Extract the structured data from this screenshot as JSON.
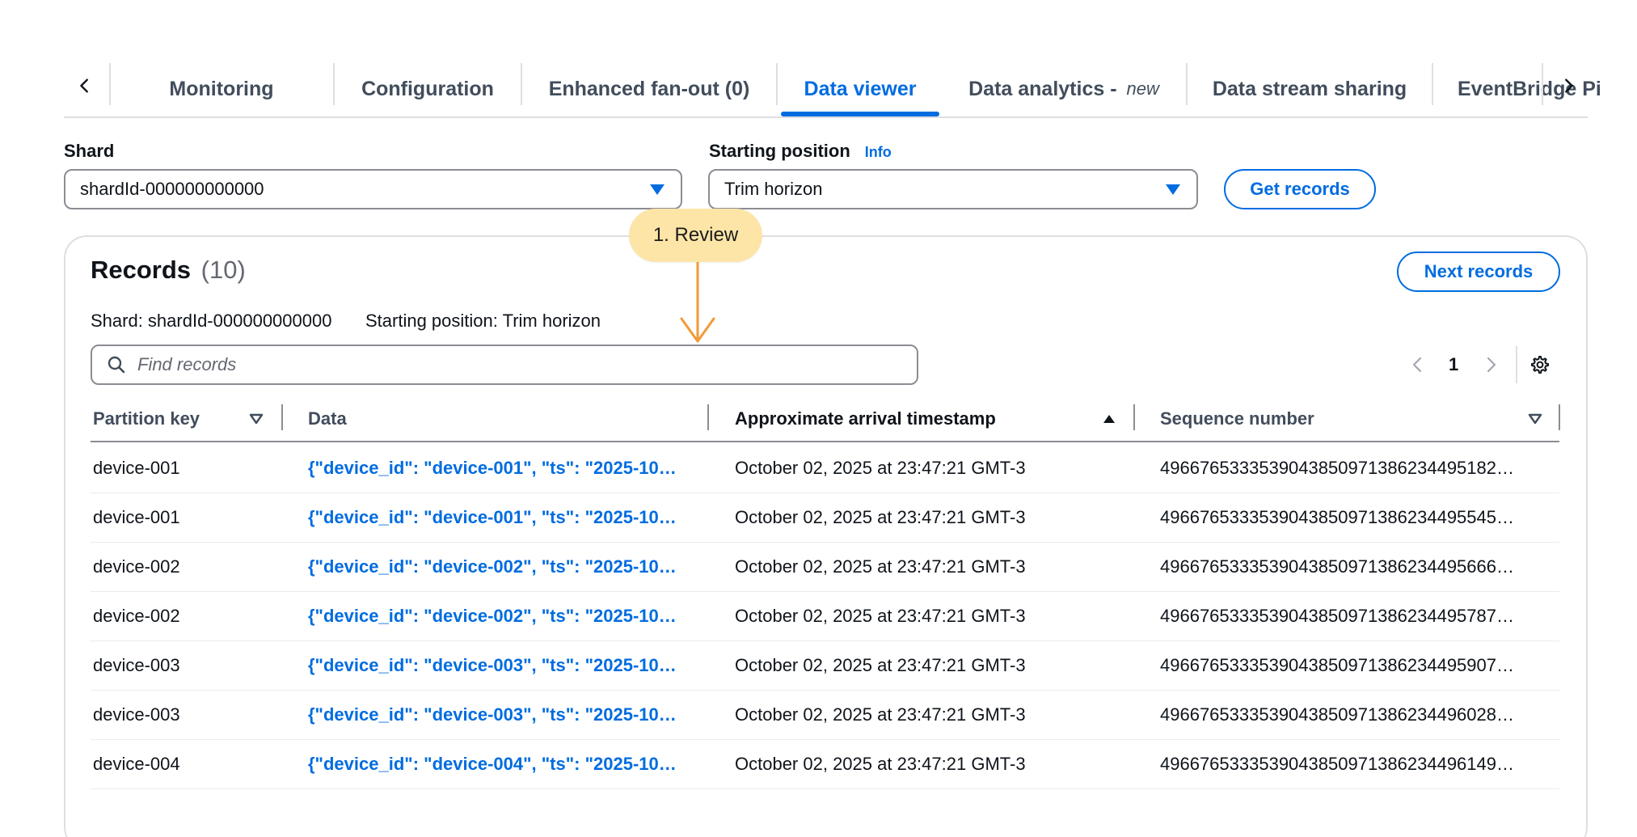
{
  "tabs": {
    "items": [
      {
        "label": "Monitoring"
      },
      {
        "label": "Configuration"
      },
      {
        "label": "Enhanced fan-out (0)"
      },
      {
        "label": "Data viewer",
        "active": true
      },
      {
        "label": "Data analytics -",
        "badge": "new"
      },
      {
        "label": "Data stream sharing"
      },
      {
        "label": "EventBridge Pi"
      }
    ]
  },
  "form": {
    "shard_label": "Shard",
    "shard_value": "shardId-000000000000",
    "starting_position_label": "Starting position",
    "info_link": "Info",
    "starting_position_value": "Trim horizon",
    "get_records_button": "Get records"
  },
  "callout": {
    "text": "1. Review",
    "color": "#fde5a8",
    "arrow_color": "#f29a38"
  },
  "records": {
    "title": "Records",
    "count": "(10)",
    "next_button": "Next records",
    "shard_meta": "Shard: shardId-000000000000",
    "position_meta": "Starting position: Trim horizon",
    "search_placeholder": "Find records",
    "page_number": "1",
    "columns": [
      {
        "label": "Partition key",
        "sort": "none"
      },
      {
        "label": "Data"
      },
      {
        "label": "Approximate arrival timestamp",
        "sort": "ascending"
      },
      {
        "label": "Sequence number",
        "sort": "none"
      }
    ],
    "rows": [
      {
        "partition_key": "device-001",
        "data": "{\"device_id\": \"device-001\", \"ts\": \"2025-10…",
        "timestamp": "October 02, 2025 at 23:47:21 GMT-3",
        "sequence": "49667653335390438509713862344951​82…"
      },
      {
        "partition_key": "device-001",
        "data": "{\"device_id\": \"device-001\", \"ts\": \"2025-10…",
        "timestamp": "October 02, 2025 at 23:47:21 GMT-3",
        "sequence": "4966765333539043850971386234495545…"
      },
      {
        "partition_key": "device-002",
        "data": "{\"device_id\": \"device-002\", \"ts\": \"2025-10…",
        "timestamp": "October 02, 2025 at 23:47:21 GMT-3",
        "sequence": "4966765333539043850971386234495666…"
      },
      {
        "partition_key": "device-002",
        "data": "{\"device_id\": \"device-002\", \"ts\": \"2025-10…",
        "timestamp": "October 02, 2025 at 23:47:21 GMT-3",
        "sequence": "4966765333539043850971386234495787…"
      },
      {
        "partition_key": "device-003",
        "data": "{\"device_id\": \"device-003\", \"ts\": \"2025-10…",
        "timestamp": "October 02, 2025 at 23:47:21 GMT-3",
        "sequence": "4966765333539043850971386234495907…"
      },
      {
        "partition_key": "device-003",
        "data": "{\"device_id\": \"device-003\", \"ts\": \"2025-10…",
        "timestamp": "October 02, 2025 at 23:47:21 GMT-3",
        "sequence": "4966765333539043850971386234496028…"
      },
      {
        "partition_key": "device-004",
        "data": "{\"device_id\": \"device-004\", \"ts\": \"2025-10…",
        "timestamp": "October 02, 2025 at 23:47:21 GMT-3",
        "sequence": "4966765333539043850971386234496149…"
      }
    ]
  },
  "icons": {
    "tab_prev": "chevron-left-icon",
    "tab_next": "chevron-right-icon",
    "search": "search-icon",
    "page_prev": "chevron-left-icon",
    "page_next": "chevron-right-icon",
    "settings": "gear-icon"
  },
  "colors": {
    "accent": "#006ce0",
    "text": "#0f141a",
    "muted": "#414d5c",
    "border": "#8c8c94"
  }
}
